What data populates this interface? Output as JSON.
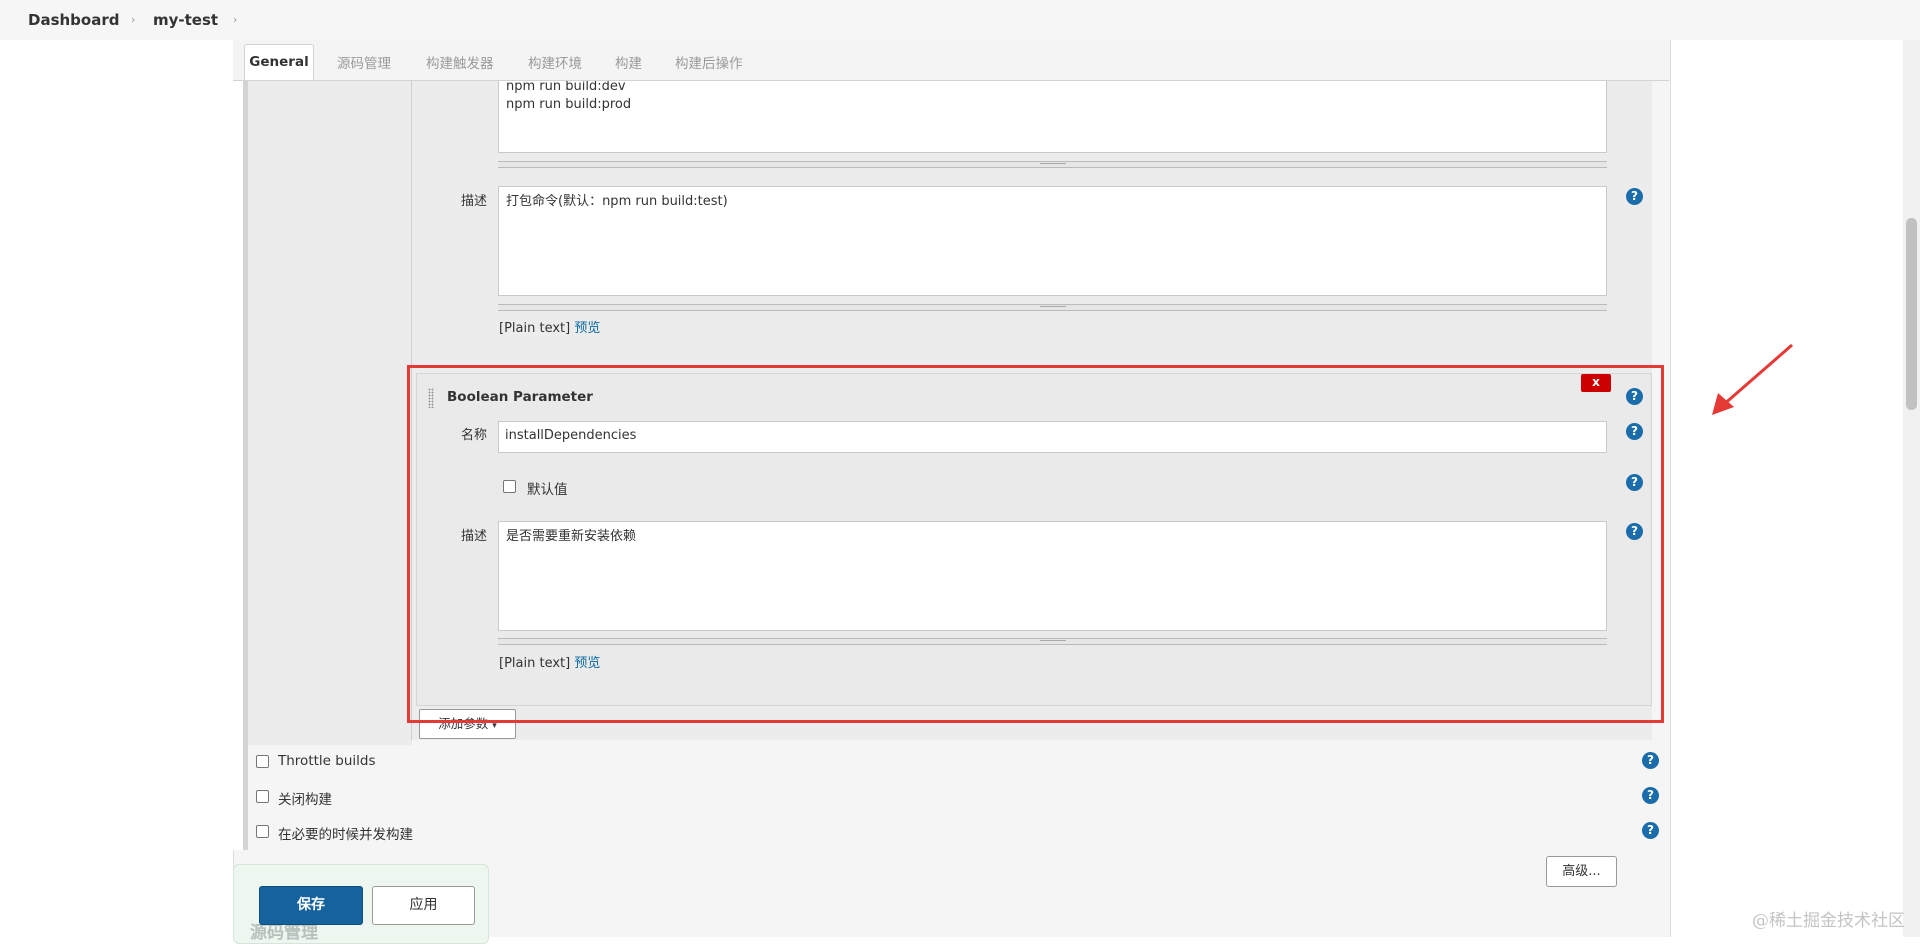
{
  "breadcrumb": {
    "root": "Dashboard",
    "job": "my-test"
  },
  "tabs": [
    "General",
    "源码管理",
    "构建触发器",
    "构建环境",
    "构建",
    "构建后操作"
  ],
  "choice_param": {
    "choices_value": "npm run build:dev\nnpm run build:prod",
    "desc_label": "描述",
    "desc_value": "打包命令(默认：npm run build:test)",
    "plain_text": "[Plain text]",
    "preview_link": "预览"
  },
  "bool_param": {
    "title": "Boolean Parameter",
    "delete_label": "x",
    "name_label": "名称",
    "name_value": "installDependencies",
    "default_label": "默认值",
    "desc_label": "描述",
    "desc_value": "是否需要重新安装依赖",
    "plain_text": "[Plain text]",
    "preview_link": "预览"
  },
  "add_param_button": "添加参数",
  "options": {
    "throttle": "Throttle builds",
    "disable": "关闭构建",
    "concurrent": "在必要的时候并发构建"
  },
  "advanced_button": "高级...",
  "footer": {
    "save": "保存",
    "apply": "应用",
    "next_section": "源码管理"
  },
  "watermark": "@稀土掘金技术社区",
  "colors": {
    "primary": "#1b6cab",
    "highlight": "#e53935",
    "delete": "#cc0000"
  }
}
